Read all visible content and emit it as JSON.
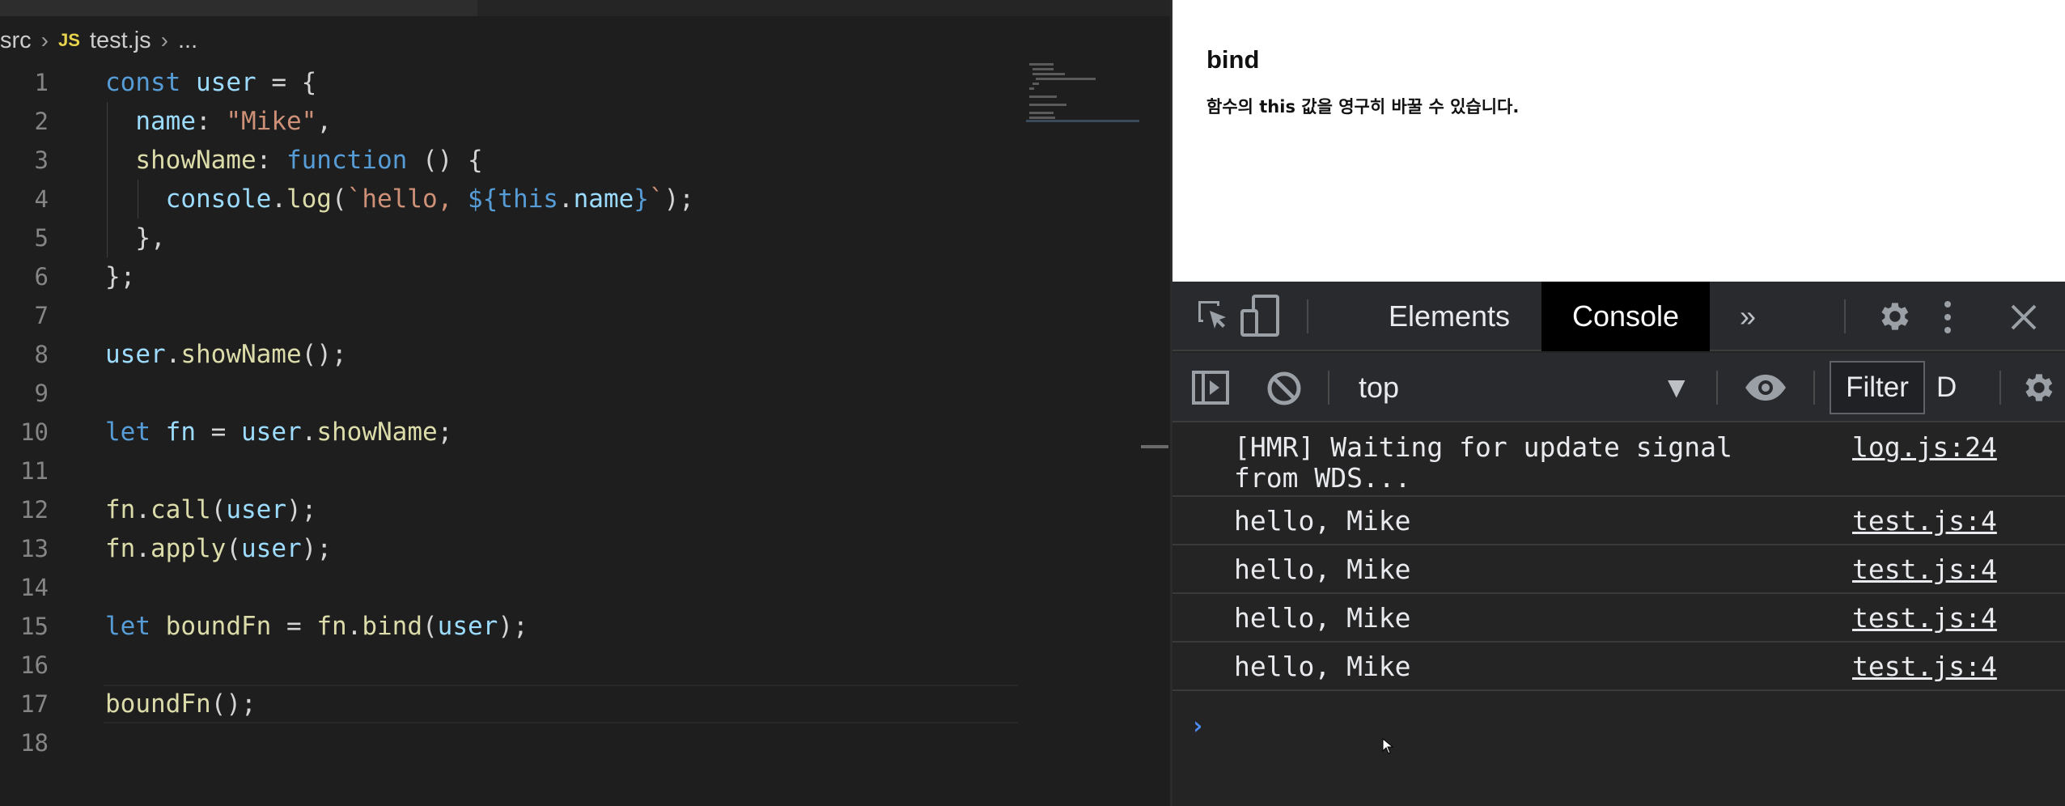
{
  "editor": {
    "breadcrumb": {
      "folder": "src",
      "file_badge": "JS",
      "file": "test.js",
      "more": "..."
    },
    "line_numbers": [
      "1",
      "2",
      "3",
      "4",
      "5",
      "6",
      "7",
      "8",
      "9",
      "10",
      "11",
      "12",
      "13",
      "14",
      "15",
      "16",
      "17",
      "18"
    ],
    "code": {
      "l1": [
        "const",
        "user",
        "=",
        "{"
      ],
      "l2": [
        "name",
        ":",
        "\"Mike\"",
        ","
      ],
      "l3": [
        "showName",
        ":",
        "function",
        "()",
        "{"
      ],
      "l4": [
        "console",
        ".",
        "log",
        "(",
        "`hello, ",
        "${",
        "this",
        ".",
        "name",
        "}",
        "`",
        ");"
      ],
      "l5": "},",
      "l6": "};",
      "l8": [
        "user",
        ".",
        "showName",
        "();"
      ],
      "l10": [
        "let",
        "fn",
        "=",
        "user",
        ".",
        "showName",
        ";"
      ],
      "l12": [
        "fn",
        ".",
        "call",
        "(",
        "user",
        ");"
      ],
      "l13": [
        "fn",
        ".",
        "apply",
        "(",
        "user",
        ");"
      ],
      "l15": [
        "let",
        "boundFn",
        "=",
        "fn",
        ".",
        "bind",
        "(",
        "user",
        ");"
      ],
      "l17": [
        "boundFn",
        "();"
      ]
    }
  },
  "page": {
    "title": "bind",
    "description": "함수의 this 값을 영구히 바꿀 수 있습니다."
  },
  "devtools": {
    "tabs": {
      "elements": "Elements",
      "console": "Console",
      "more": "»"
    },
    "toolbar": {
      "context": "top",
      "filter": "Filter",
      "levels": "D"
    },
    "messages": [
      {
        "text": "[HMR] Waiting for update signal\nfrom WDS...",
        "source": "log.js:24"
      },
      {
        "text": "hello, Mike",
        "source": "test.js:4"
      },
      {
        "text": "hello, Mike",
        "source": "test.js:4"
      },
      {
        "text": "hello, Mike",
        "source": "test.js:4"
      },
      {
        "text": "hello, Mike",
        "source": "test.js:4"
      }
    ],
    "prompt": "›"
  }
}
